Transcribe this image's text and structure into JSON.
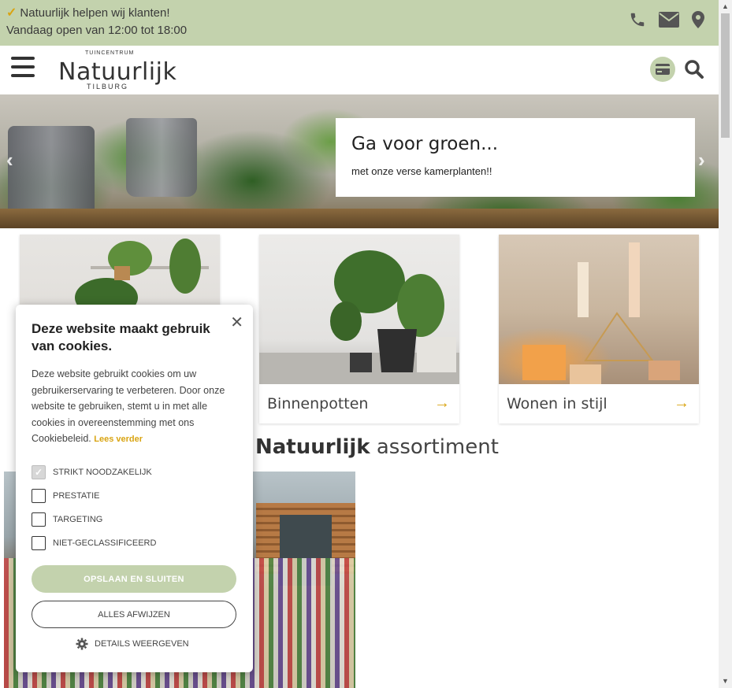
{
  "topbar": {
    "tagline": "Natuurlijk helpen wij klanten!",
    "hours": "Vandaag open van 12:00 tot 18:00",
    "icons": [
      "phone-icon",
      "mail-icon",
      "location-icon"
    ]
  },
  "header": {
    "logo_top": "TUINCENTRUM",
    "logo_main": "Natuurlijk",
    "logo_bottom": "TILBURG",
    "icons": [
      "menu-icon",
      "card-icon",
      "search-icon"
    ]
  },
  "hero": {
    "title": "Ga voor groen...",
    "subtitle": "met onze verse kamerplanten!!"
  },
  "tiles": [
    {
      "label": ""
    },
    {
      "label": "Binnenpotten"
    },
    {
      "label": "Wonen in stijl"
    }
  ],
  "section": {
    "title_bold": "Natuurlijk",
    "title_rest": " assortiment"
  },
  "cookie": {
    "title": "Deze website maakt gebruik van cookies.",
    "description": "Deze website gebruikt cookies om uw gebruikerservaring te verbeteren. Door onze website te gebruiken, stemt u in met alle cookies in overeenstemming met ons Cookiebeleid.",
    "read_more": "Lees verder",
    "options": [
      {
        "label": "STRIKT NOODZAKELIJK",
        "checked": true
      },
      {
        "label": "PRESTATIE",
        "checked": false
      },
      {
        "label": "TARGETING",
        "checked": false
      },
      {
        "label": "NIET-GECLASSIFICEERD",
        "checked": false
      }
    ],
    "save_button": "OPSLAAN EN SLUITEN",
    "reject_button": "ALLES AFWIJZEN",
    "details_button": "DETAILS WEERGEVEN"
  },
  "colors": {
    "brand_green": "#c3d2ad",
    "accent_gold": "#d9a412"
  }
}
